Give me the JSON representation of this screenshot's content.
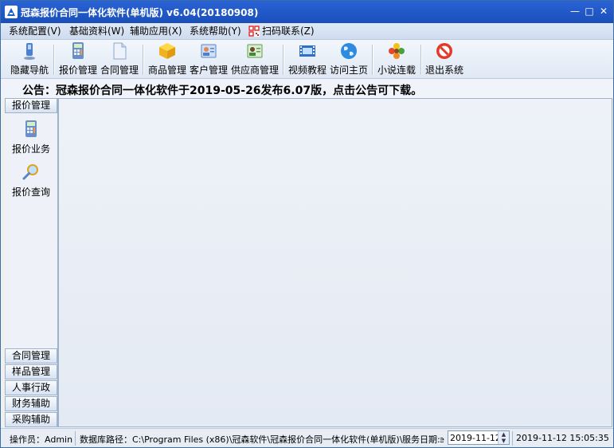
{
  "titlebar": {
    "title": "冠森报价合同一体化软件(单机版) v6.04(20180908)",
    "minimize": "—",
    "maximize": "□",
    "close": "✕"
  },
  "menu": [
    {
      "label": "系统配置(V)"
    },
    {
      "label": "基础资料(W)"
    },
    {
      "label": "辅助应用(X)"
    },
    {
      "label": "系统帮助(Y)"
    },
    {
      "label": "扫码联系(Z)",
      "icon": "qr-code-icon"
    }
  ],
  "toolbar": [
    {
      "label": "隐藏导航",
      "icon": "hide-nav-icon"
    },
    {
      "label": "报价管理",
      "icon": "calculator-icon"
    },
    {
      "label": "合同管理",
      "icon": "document-icon"
    },
    {
      "label": "商品管理",
      "icon": "package-icon"
    },
    {
      "label": "客户管理",
      "icon": "contact-card-icon"
    },
    {
      "label": "供应商管理",
      "icon": "supplier-card-icon"
    },
    {
      "label": "视频教程",
      "icon": "film-icon"
    },
    {
      "label": "访问主页",
      "icon": "globe-icon"
    },
    {
      "label": "小说连载",
      "icon": "flower-icon"
    },
    {
      "label": "退出系统",
      "icon": "stop-icon"
    }
  ],
  "notice": "公告：冠森报价合同一体化软件于2019-05-26发布6.07版，点击公告可下载。",
  "sidebar": {
    "active_group": "报价管理",
    "items": [
      {
        "label": "报价业务",
        "icon": "calculator-icon"
      },
      {
        "label": "报价查询",
        "icon": "magnifier-icon"
      }
    ],
    "groups": [
      "合同管理",
      "样品管理",
      "人事行政",
      "财务辅助",
      "采购辅助"
    ]
  },
  "status": {
    "operator": "操作员：Admin",
    "db_path": "数据库路径：C:\\Program Files (x86)\\冠森软件\\冠森报价合同一体化软件(单机版)\\Database",
    "service_date_label": "服务日期:",
    "service_date": "2019-11-12",
    "clock": "2019-11-12 15:05:35"
  },
  "colors": {
    "titlebar": "#2a63d6",
    "sidebar": "#eef2f8",
    "main": "#e4eaf3"
  }
}
